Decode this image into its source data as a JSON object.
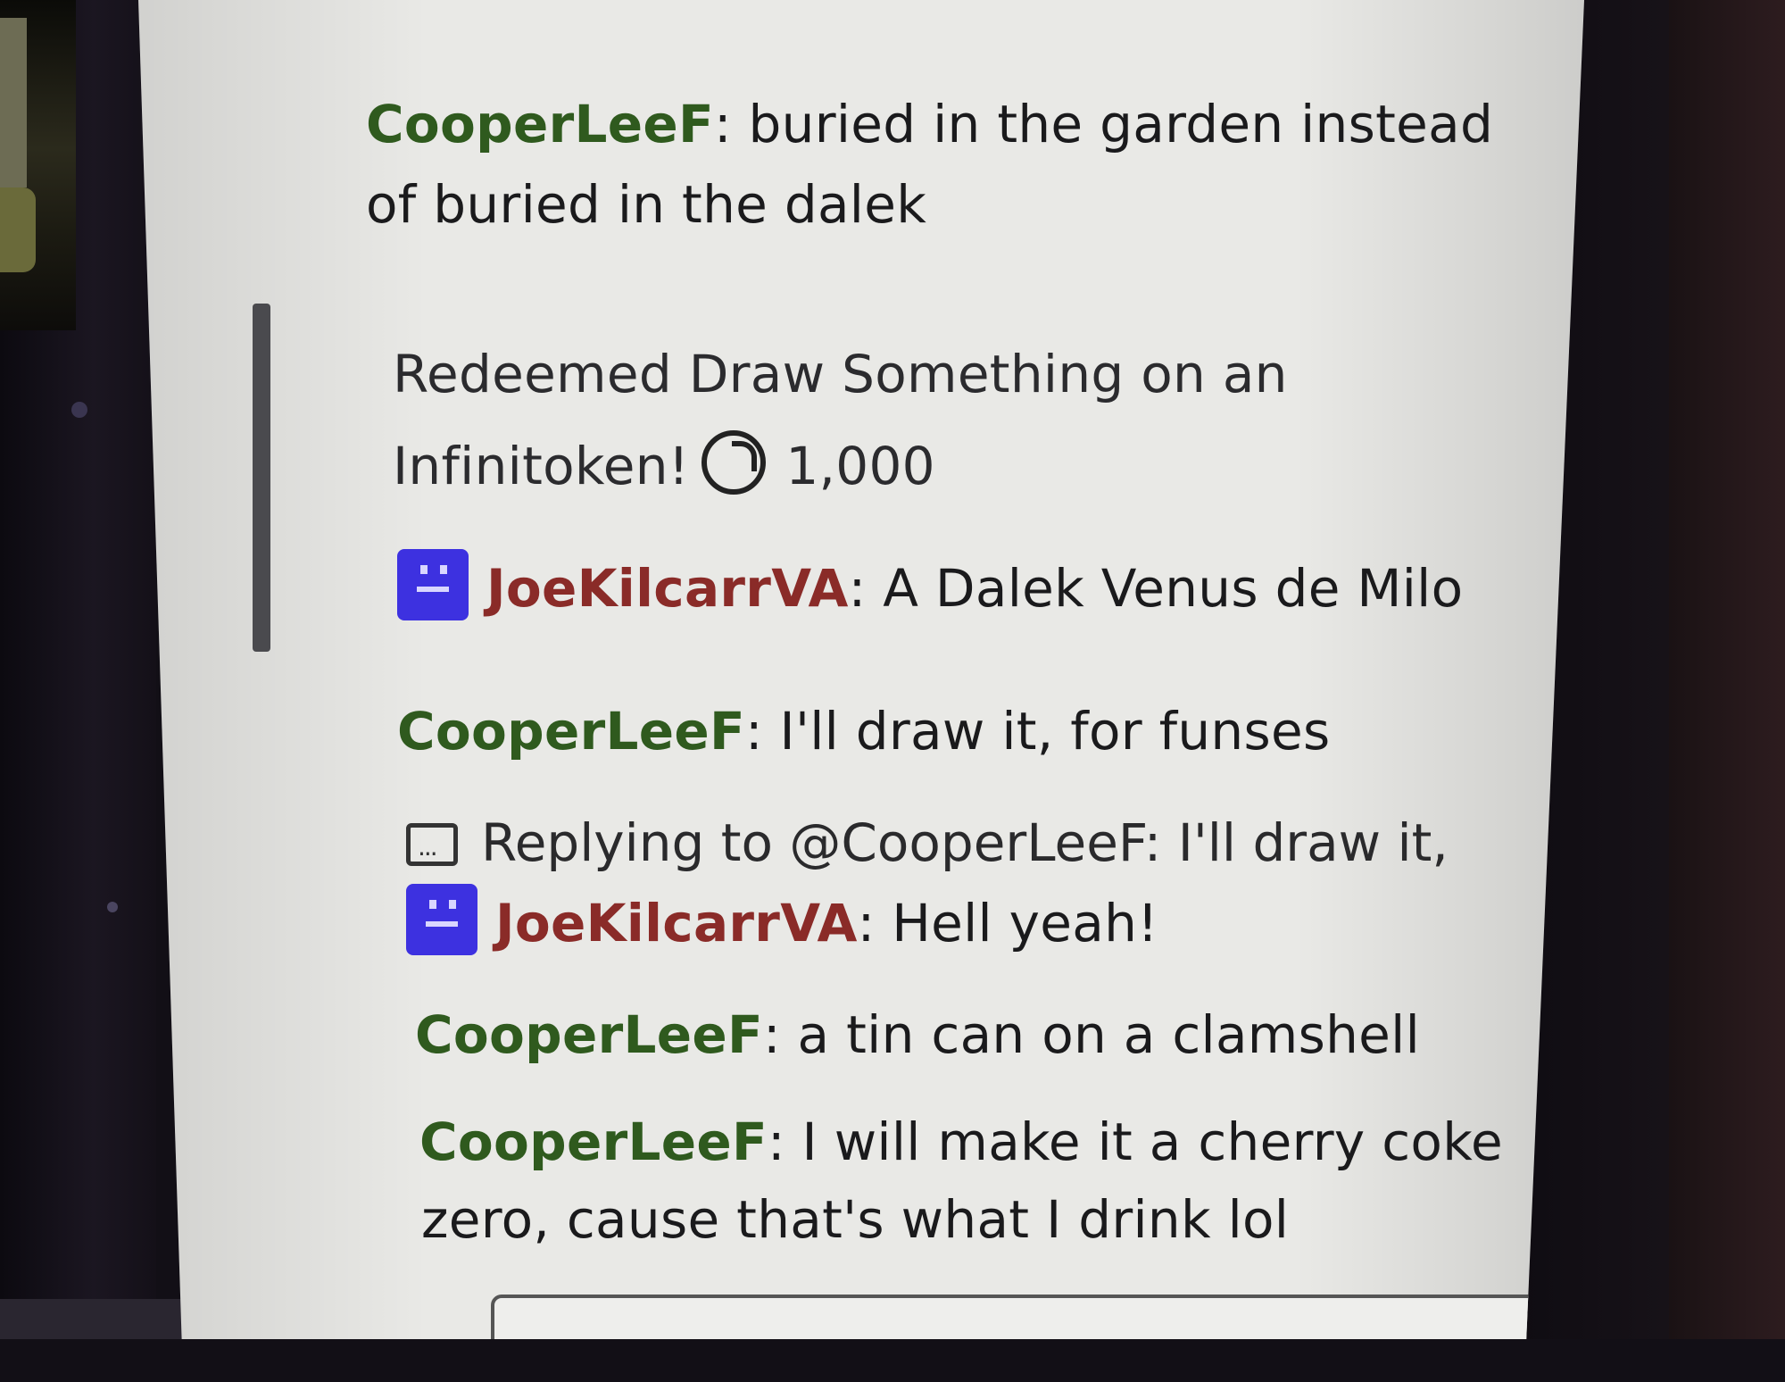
{
  "chat": {
    "messages": [
      {
        "user": "CooperLeeF",
        "text": "buried in the garden instead",
        "text2": "of buried in the dalek"
      },
      {
        "redeem_line1": "Redeemed Draw Something on an",
        "redeem_line2": "Infinitoken!",
        "cost": "1,000"
      },
      {
        "user": "JoeKilcarrVA",
        "text": "A Dalek Venus de Milo"
      },
      {
        "user": "CooperLeeF",
        "text": "I'll draw it, for funses"
      },
      {
        "reply": "Replying to @CooperLeeF: I'll draw it, f..."
      },
      {
        "user": "JoeKilcarrVA",
        "text": "Hell yeah!"
      },
      {
        "user": "CooperLeeF",
        "text": "a tin can on a clamshell"
      },
      {
        "user": "CooperLeeF",
        "text": "I will make it a cherry coke",
        "text2": "zero, cause that's what I drink lol"
      }
    ],
    "icons": {
      "token": "channel-points-icon",
      "badge": "subscriber-badge-icon",
      "reply": "reply-bubble-icon"
    },
    "colors": {
      "cooper": "#2f5a1e",
      "joe": "#8a2b28",
      "badge": "#3d31e0"
    }
  }
}
